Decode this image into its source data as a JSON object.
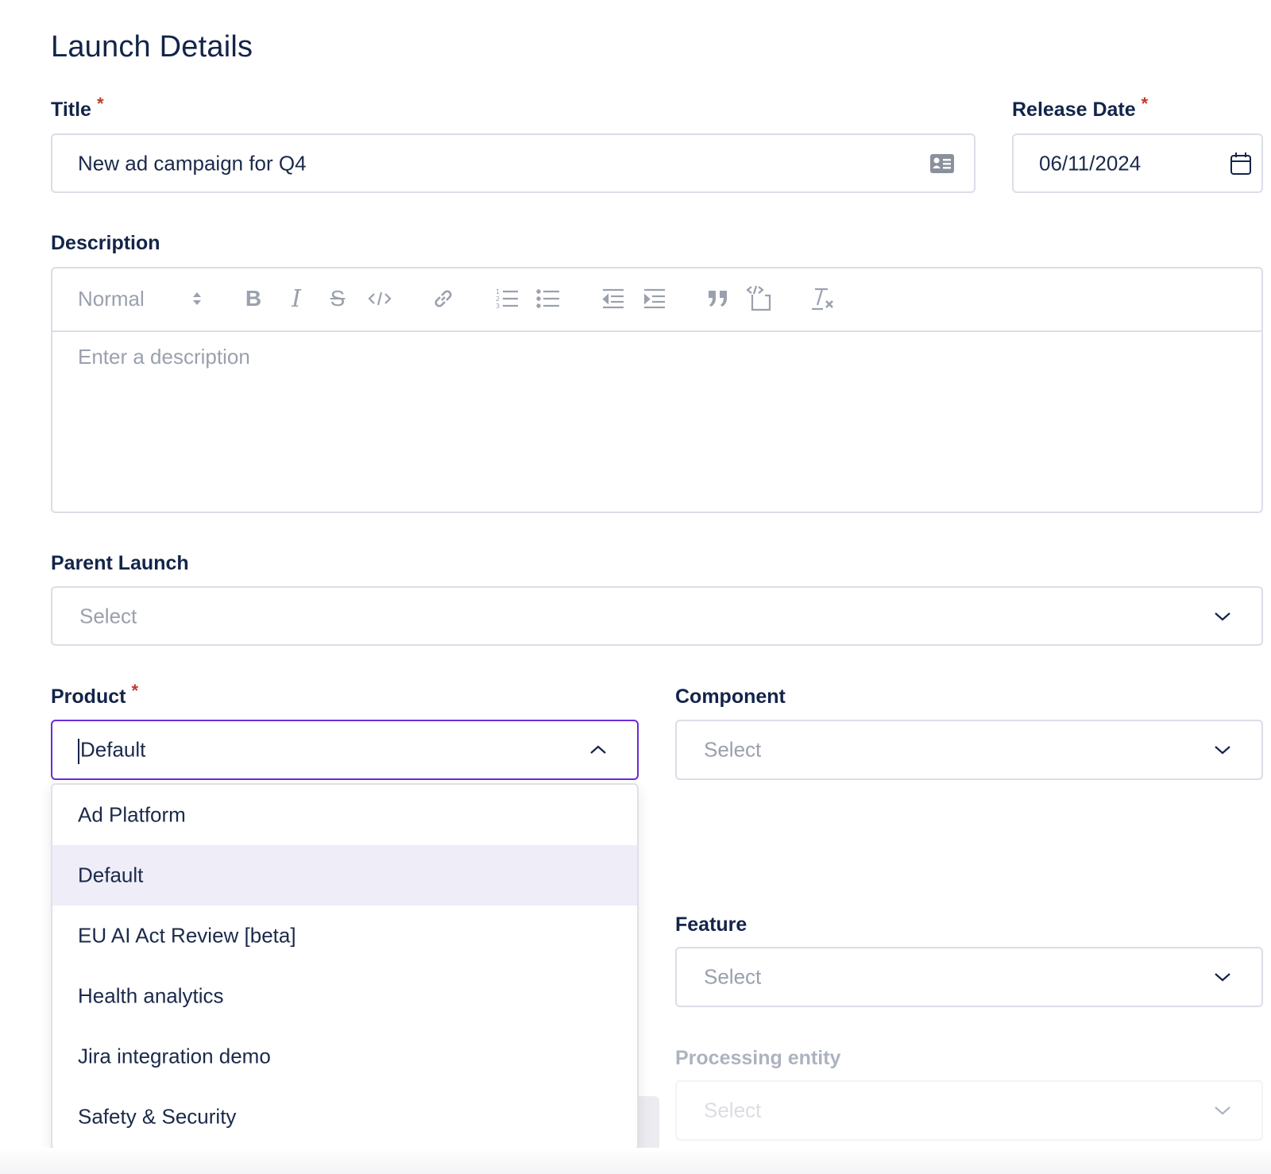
{
  "heading": "Launch Details",
  "title_field": {
    "label": "Title",
    "required_mark": "*",
    "value": "New ad campaign for Q4",
    "icon": "id-card-icon"
  },
  "release_date": {
    "label": "Release Date",
    "required_mark": "*",
    "value": "06/11/2024",
    "icon": "calendar-icon"
  },
  "description": {
    "label": "Description",
    "format_select": "Normal",
    "placeholder": "Enter a description",
    "toolbar": [
      "bold-icon",
      "italic-icon",
      "strikethrough-icon",
      "code-icon",
      "link-icon",
      "ordered-list-icon",
      "bullet-list-icon",
      "outdent-icon",
      "indent-icon",
      "quote-icon",
      "code-block-icon",
      "clear-format-icon"
    ]
  },
  "parent_launch": {
    "label": "Parent Launch",
    "placeholder": "Select"
  },
  "product": {
    "label": "Product",
    "required_mark": "*",
    "value": "Default",
    "options": [
      "Ad Platform",
      "Default",
      "EU AI Act Review [beta]",
      "Health analytics",
      "Jira integration demo",
      "Safety & Security"
    ],
    "selected_option": "Default"
  },
  "component": {
    "label": "Component",
    "placeholder": "Select"
  },
  "feature": {
    "label": "Feature",
    "placeholder": "Select"
  },
  "processing_entity": {
    "label": "Processing entity",
    "placeholder": "Select"
  },
  "colors": {
    "accent_border": "#6a2bd9",
    "selected_option_bg": "#eeedf8",
    "required": "#c0392b"
  }
}
